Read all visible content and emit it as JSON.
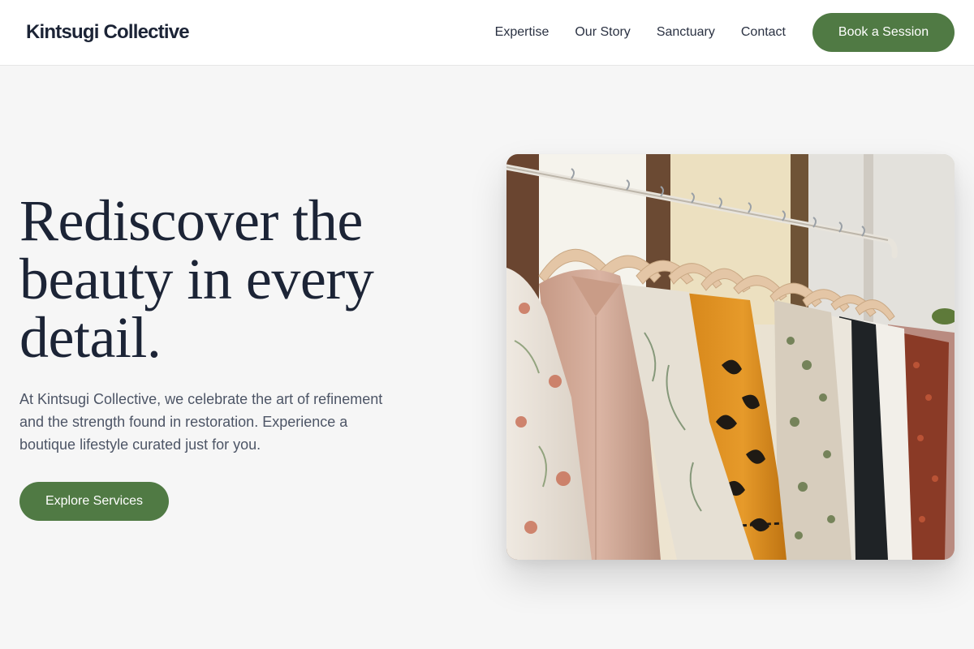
{
  "header": {
    "brand": "Kintsugi Collective",
    "nav": [
      {
        "label": "Expertise"
      },
      {
        "label": "Our Story"
      },
      {
        "label": "Sanctuary"
      },
      {
        "label": "Contact"
      }
    ],
    "cta_label": "Book a Session"
  },
  "hero": {
    "title": "Rediscover the beauty in every detail.",
    "description": "At Kintsugi Collective, we celebrate the art of refinement and the strength found in restoration. Experience a boutique lifestyle curated just for you.",
    "cta_label": "Explore Services",
    "image_subject": "clothing-rack-photo"
  },
  "colors": {
    "accent": "#507a44",
    "heading": "#1c2436",
    "body_text": "#4d5566",
    "background": "#f6f6f6"
  }
}
